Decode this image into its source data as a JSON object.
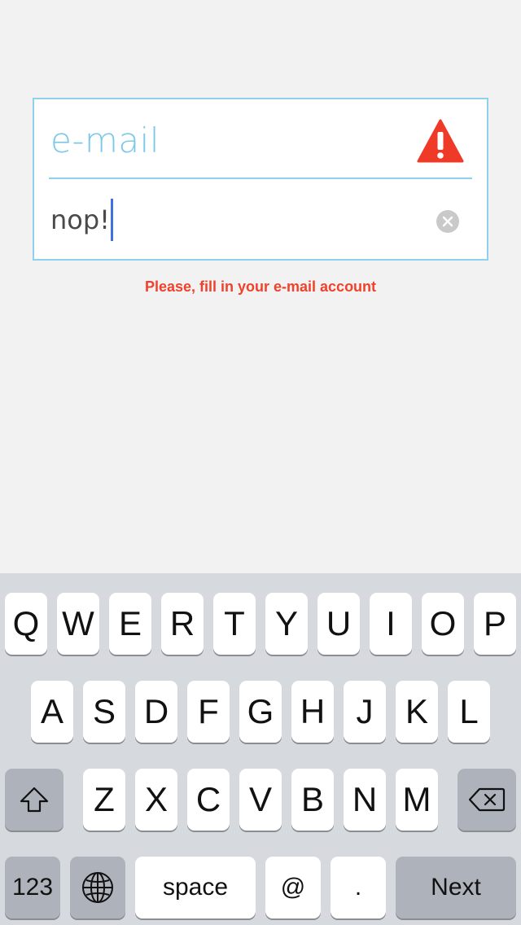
{
  "form": {
    "field_label": "e-mail",
    "input_value": "nop!",
    "error_message": "Please, fill in your e-mail account"
  },
  "colors": {
    "accent_blue": "#7cc8ea",
    "error_red": "#f0412b",
    "warning_red": "#ee3a27"
  },
  "icons": {
    "warning": "warning-icon",
    "clear": "clear-icon",
    "shift": "shift-icon",
    "backspace": "backspace-icon",
    "globe": "globe-icon"
  },
  "keyboard": {
    "row1": [
      "Q",
      "W",
      "E",
      "R",
      "T",
      "Y",
      "U",
      "I",
      "O",
      "P"
    ],
    "row2": [
      "A",
      "S",
      "D",
      "F",
      "G",
      "H",
      "J",
      "K",
      "L"
    ],
    "row3": [
      "Z",
      "X",
      "C",
      "V",
      "B",
      "N",
      "M"
    ],
    "numbers_label": "123",
    "space_label": "space",
    "at_label": "@",
    "dot_label": ".",
    "next_label": "Next"
  }
}
